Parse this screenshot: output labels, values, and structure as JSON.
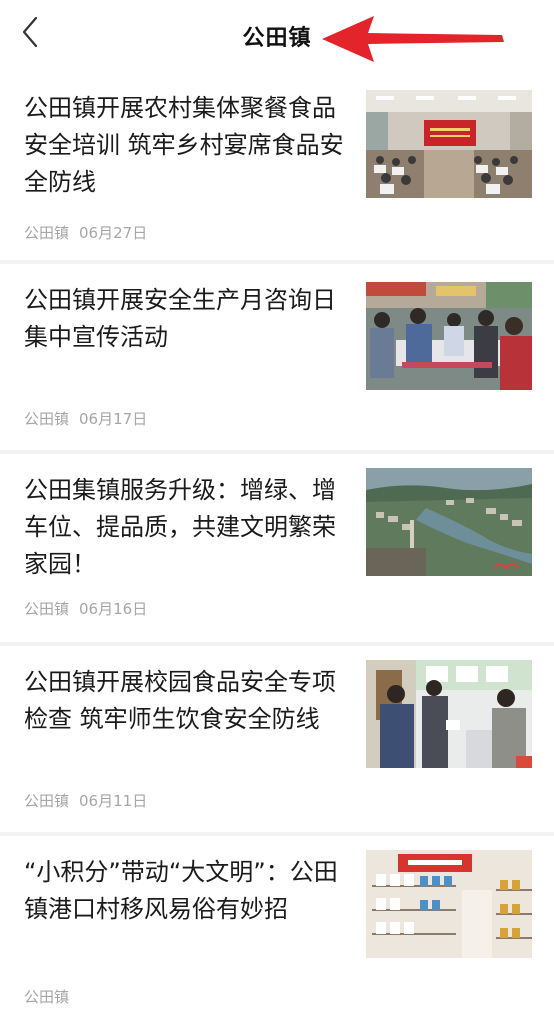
{
  "header": {
    "title": "公田镇",
    "back_icon": "chevron-left-icon",
    "annotation": "red-arrow"
  },
  "articles": [
    {
      "title": "公田镇开展农村集体聚餐食品安全培训 筑牢乡村宴席食品安全防线",
      "source": "公田镇",
      "date": "06月27日",
      "image": "meeting-hall-training-photo"
    },
    {
      "title": "公田镇开展安全生产月咨询日集中宣传活动",
      "source": "公田镇",
      "date": "06月17日",
      "image": "street-promotion-booth-photo"
    },
    {
      "title": "公田集镇服务升级：增绿、增车位、提品质，共建文明繁荣家园！",
      "source": "公田镇",
      "date": "06月16日",
      "image": "aerial-town-river-photo"
    },
    {
      "title": "公田镇开展校园食品安全专项检查 筑牢师生饮食安全防线",
      "source": "公田镇",
      "date": "06月11日",
      "image": "school-kitchen-inspection-photo"
    },
    {
      "title": "“小积分”带动“大文明”：公田镇港口村移风易俗有妙招",
      "source": "公田镇",
      "date": "",
      "image": "points-supermarket-shelves-photo"
    }
  ]
}
